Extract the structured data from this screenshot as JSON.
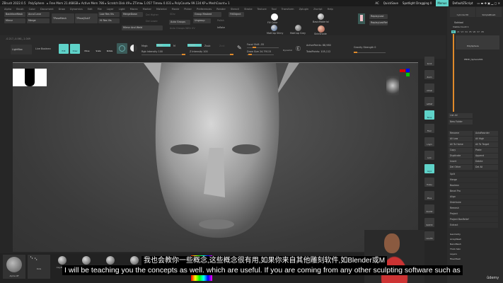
{
  "titlebar": {
    "app": "ZBrush 2022.0.5",
    "tool": "PolySphere",
    "stats": "▸ Free Mem 21.468GB ▸ Active Mem 786 ▸ Scratch Disk 49 ▸ ZTime▸ 1.057 Timer▸ 0.031 ▸ PolyCount▸ 99.134 KP ▸ MeshCount ▸ 1",
    "ac": "AC",
    "quicksave": "QuickSave",
    "spotlight": "Spotlight Dragging 0",
    "menus": "Menus",
    "script": "DefaultZScript"
  },
  "menus": [
    "Alpha",
    "Brush",
    "Color",
    "Document",
    "Draw",
    "Dynamics",
    "Edit",
    "File",
    "Layer",
    "Light",
    "Macro",
    "Marker",
    "Material",
    "Movie",
    "Picker",
    "Preferences",
    "Render",
    "Stencil",
    "Stroke",
    "Texture",
    "Tool",
    "Transform",
    "Zplugin",
    "Zscript",
    "Help"
  ],
  "topbuttons": {
    "backface": "BackfaceMask",
    "acc": "AccuCurve",
    "mirror": "Mirror",
    "merge": "Merge",
    "tpose": "TPoseMesh",
    "tposesub": "TPose|SubT",
    "lowres": "Low Res Vis",
    "hires": "Hi Res Vis",
    "mergedown": "MergeDown",
    "delhigher": "Del Higher",
    "dellower": "Del Lower",
    "mirrorweld": "Mirror And Weld",
    "sdiv": "SDiv",
    "autogroups": "Auto Groups",
    "autogroupsuv": "Auto Groups With UV",
    "groupmasked": "Group Masked",
    "ungroup": "Ungroup",
    "polish": "Polish",
    "inflate": "Inflate",
    "fillobject": "FillObject",
    "fillcolor": "Fill Color",
    "basicmat": "BasicMaterial",
    "shiny": "MatCap Shiny",
    "matcapgrey": "MatCap Grey",
    "skinshade": "SkinShade",
    "replaylast": "ReplayLast",
    "replaylastrel": "ReplayLastRel"
  },
  "tray": {
    "cylinder": "Cylinder3D",
    "simplebrush": "SimpleBrush",
    "subtool": "Subtool",
    "visible": "Visible Count 1",
    "v_tabs": [
      "V1",
      "V2",
      "V3",
      "V4",
      "V5",
      "V6",
      "V7",
      "V8"
    ],
    "items": [
      "PolySphere",
      "PM3D_Sphere3D1"
    ],
    "listall": "List All",
    "newfolder": "New Folder",
    "ops": [
      "Rename",
      "AutoReorder",
      "All Low",
      "All High",
      "All To Home",
      "All To Target",
      "Copy",
      "Paste",
      "Duplicate",
      "Append",
      "Insert",
      "Delete",
      "Del Other",
      "Del All"
    ],
    "actions": [
      "Split",
      "Merge",
      "Boolean",
      "Bevel Pro",
      "Align",
      "Distribute",
      "Remesh",
      "Project",
      "Project BasRelief",
      "Extract"
    ],
    "sections": [
      "Geometry",
      "ArrayMesh",
      "NanoMesh",
      "Thick Skin",
      "Layers",
      "FiberMesh"
    ],
    "watermark": "ûdemy"
  },
  "toolbar": {
    "coords": "-0.217,-0.061,-1.049",
    "lightbox": "LightBox",
    "liveboolean": "Live Boolean",
    "edit": "Edit",
    "draw": "Draw",
    "move": "Move",
    "scale": "Scale",
    "rotate": "Rotate",
    "mrgb": "Mrgb",
    "rgb": "Rgb",
    "m": "M",
    "zadd": "Zadd",
    "zsub": "Zsub",
    "zcut": "Zcut",
    "rgbint": "Rgb Intensity 100",
    "zint": "Z Intensity 100",
    "focal": "Focal Shift -55",
    "drawsize": "Draw Size 24.79115",
    "dynamic": "Dynamic",
    "active": "ActivePoints: 88,980",
    "total": "TotalPoints: 105,112",
    "gravity": "Gravity Strength 0"
  },
  "rightshelf": [
    "Scroll",
    "Zoom",
    "Actual",
    "AAHalf",
    "Persp",
    "Floor",
    "L.Sym",
    "Lock",
    "Gxyz",
    "Frame",
    "Move",
    "ZoomD",
    "RotXYZ",
    "Line Fill"
  ],
  "shelf": {
    "alpha": "Alpha Off",
    "stroke": "Dots",
    "brushes": [
      "ClayBuildup",
      "Standard",
      "Move",
      "DamStandard",
      "Pinch",
      "Inflat"
    ]
  },
  "subtitles": {
    "cn": "我也会教你一些概念,这些概念很有用,如果你来自其他雕刻软件,如Blender或M",
    "en": "I will be teaching you the concepts as well. which are useful. If you are coming from any other sculpting software such as"
  },
  "colors": {
    "accent": "#5fd3c9",
    "slider": "#e08a2a"
  }
}
